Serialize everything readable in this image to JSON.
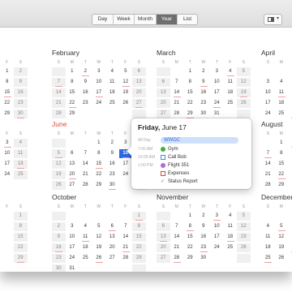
{
  "toolbar": {
    "views": [
      {
        "label": "Day",
        "active": false
      },
      {
        "label": "Week",
        "active": false
      },
      {
        "label": "Month",
        "active": false
      },
      {
        "label": "Year",
        "active": true
      },
      {
        "label": "List",
        "active": false
      }
    ],
    "sidebar_toggle_icon": "sidebar-toggle-icon"
  },
  "dow_labels": [
    "S",
    "M",
    "T",
    "W",
    "T",
    "F",
    "S"
  ],
  "months": [
    {
      "name": "",
      "partial": "left",
      "weeks": [
        [
          "",
          "",
          "",
          "",
          "",
          "1",
          "2"
        ],
        [
          "",
          "",
          "",
          "",
          "",
          "8",
          "9"
        ],
        [
          "",
          "",
          "",
          "",
          "",
          "15",
          "16"
        ],
        [
          "",
          "",
          "",
          "",
          "",
          "22",
          "23"
        ],
        [
          "",
          "",
          "",
          "",
          "",
          "29",
          "30"
        ]
      ]
    },
    {
      "name": "February",
      "weeks": [
        [
          "",
          "1",
          "2",
          "3",
          "4",
          "5",
          "6"
        ],
        [
          "7",
          "8",
          "9",
          "10",
          "11",
          "12",
          "13"
        ],
        [
          "14",
          "15",
          "16",
          "17",
          "18",
          "19",
          "20"
        ],
        [
          "21",
          "22",
          "23",
          "24",
          "25",
          "26",
          "27"
        ],
        [
          "28",
          "29",
          "",
          "",
          "",
          "",
          ""
        ]
      ]
    },
    {
      "name": "March",
      "weeks": [
        [
          "",
          "",
          "1",
          "2",
          "3",
          "4",
          "5"
        ],
        [
          "6",
          "7",
          "8",
          "9",
          "10",
          "11",
          "12"
        ],
        [
          "13",
          "14",
          "15",
          "16",
          "17",
          "18",
          "19"
        ],
        [
          "20",
          "21",
          "22",
          "23",
          "24",
          "25",
          "26"
        ],
        [
          "27",
          "28",
          "29",
          "30",
          "31",
          "",
          ""
        ]
      ]
    },
    {
      "name": "April",
      "partial": "right",
      "weeks": [
        [
          "",
          "",
          "",
          ""
        ],
        [
          "3",
          "4",
          "5",
          "6"
        ],
        [
          "10",
          "11",
          "12",
          "13"
        ],
        [
          "17",
          "18",
          "19",
          "20"
        ],
        [
          "24",
          "25",
          "26",
          "27"
        ]
      ]
    },
    {
      "name": "",
      "partial": "left",
      "weeks": [
        [
          "",
          "",
          "",
          "",
          "",
          "3",
          "4"
        ],
        [
          "",
          "",
          "",
          "",
          "",
          "10",
          "11"
        ],
        [
          "",
          "",
          "",
          "",
          "",
          "17",
          "18"
        ],
        [
          "",
          "",
          "",
          "",
          "",
          "24",
          "25"
        ]
      ]
    },
    {
      "name": "June",
      "weeks": [
        [
          "",
          "",
          "",
          "1",
          "2",
          "3",
          "4"
        ],
        [
          "5",
          "6",
          "7",
          "8",
          "9",
          "10",
          "11"
        ],
        [
          "12",
          "13",
          "14",
          "15",
          "16",
          "17",
          "18"
        ],
        [
          "19",
          "20",
          "21",
          "22",
          "23",
          "24",
          "25"
        ],
        [
          "26",
          "27",
          "28",
          "29",
          "30",
          "",
          ""
        ]
      ]
    },
    {
      "name": "August",
      "partial": "right",
      "weeks": [
        [
          "",
          "1",
          "2",
          "3"
        ],
        [
          "7",
          "8",
          "9",
          "10"
        ],
        [
          "14",
          "15",
          "16",
          "17"
        ],
        [
          "21",
          "22",
          "23",
          "24"
        ],
        [
          "28",
          "29",
          "30",
          "31"
        ]
      ]
    },
    {
      "name": "",
      "partial": "left",
      "weeks": [
        [
          "",
          "",
          "",
          "",
          "",
          "",
          "1"
        ],
        [
          "",
          "",
          "",
          "",
          "",
          "",
          "8"
        ],
        [
          "",
          "",
          "",
          "",
          "",
          "",
          "15"
        ],
        [
          "",
          "",
          "",
          "",
          "",
          "",
          "22"
        ],
        [
          "",
          "",
          "",
          "",
          "",
          "",
          "29"
        ]
      ]
    },
    {
      "name": "October",
      "weeks": [
        [
          "",
          "",
          "",
          "",
          "",
          "",
          "1"
        ],
        [
          "2",
          "3",
          "4",
          "5",
          "6",
          "7",
          "8"
        ],
        [
          "9",
          "10",
          "11",
          "12",
          "13",
          "14",
          "15"
        ],
        [
          "16",
          "17",
          "18",
          "19",
          "20",
          "21",
          "22"
        ],
        [
          "23",
          "24",
          "25",
          "26",
          "27",
          "28",
          "29"
        ],
        [
          "30",
          "31",
          "",
          "",
          "",
          "",
          ""
        ]
      ]
    },
    {
      "name": "November",
      "weeks": [
        [
          "",
          "",
          "1",
          "2",
          "3",
          "4",
          "5"
        ],
        [
          "6",
          "7",
          "8",
          "9",
          "10",
          "11",
          "12"
        ],
        [
          "13",
          "14",
          "15",
          "16",
          "17",
          "18",
          "19"
        ],
        [
          "20",
          "21",
          "22",
          "23",
          "24",
          "25",
          "26"
        ],
        [
          "27",
          "28",
          "29",
          "30",
          "",
          "",
          ""
        ]
      ]
    },
    {
      "name": "December",
      "partial": "right",
      "weeks": [
        [
          "",
          "",
          "",
          ""
        ],
        [
          "4",
          "5",
          "6",
          "7"
        ],
        [
          "11",
          "12",
          "13",
          "14"
        ],
        [
          "18",
          "19",
          "20",
          "21"
        ],
        [
          "25",
          "26",
          "27",
          "28"
        ]
      ]
    }
  ],
  "selected_day": "10",
  "popover": {
    "weekday": "Friday,",
    "date": "June 17",
    "allday_label": "All Day",
    "allday_event": "WWDC",
    "events": [
      {
        "time": "7:00 AM",
        "title": "Gym",
        "icon": "green-dot-icon",
        "color": "#3cb043"
      },
      {
        "time": "10:00 AM",
        "title": "Call Bob",
        "icon": "blue-square-icon",
        "color": "#4a86e8"
      },
      {
        "time": "1:00 PM",
        "title": "Flight 351",
        "icon": "purple-dot-icon",
        "color": "#b469d8"
      },
      {
        "time": "",
        "title": "Expenses",
        "icon": "red-square-icon",
        "color": "#e0453a"
      },
      {
        "time": "",
        "title": "Status Report",
        "icon": "checkmark-icon",
        "color": "#3a6fd8"
      }
    ]
  },
  "colors": {
    "accent": "#2a6ae0",
    "month_red": "#e0453a"
  }
}
